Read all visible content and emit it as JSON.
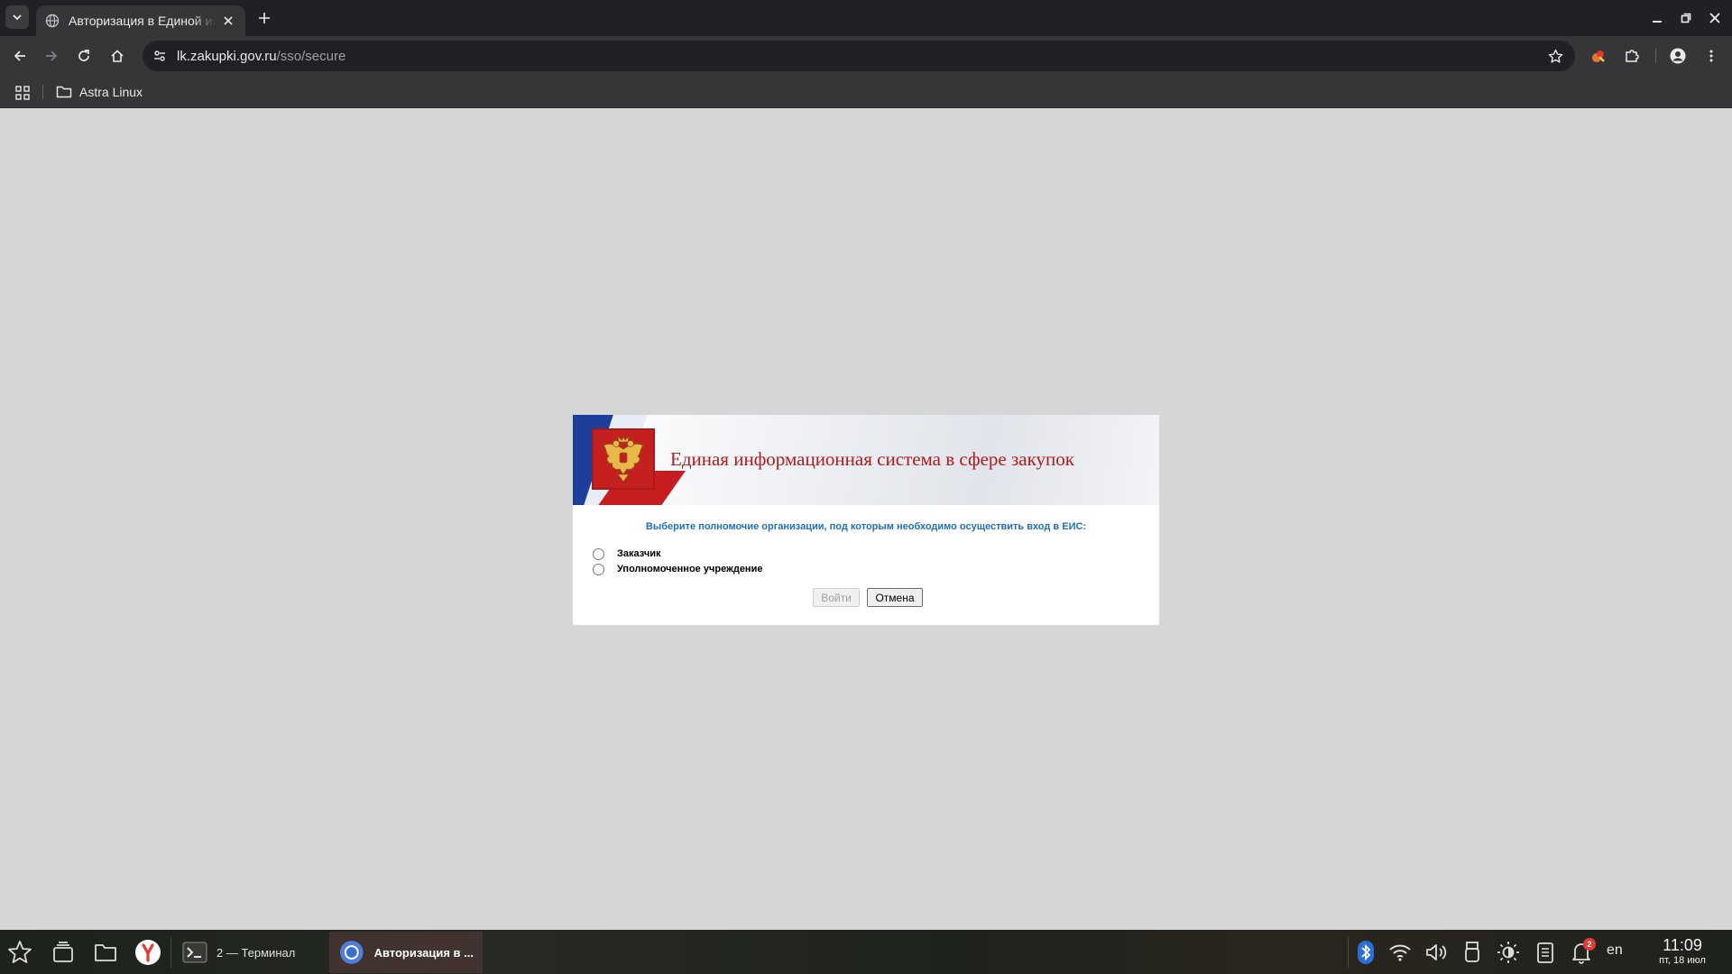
{
  "browser": {
    "tab": {
      "title": "Авторизация в Единой информационной системе",
      "favicon": "globe-icon"
    },
    "url": {
      "host": "lk.zakupki.gov.ru",
      "path": "/sso/secure"
    },
    "bookmarks": [
      {
        "label": "Astra Linux",
        "icon": "folder-icon"
      }
    ]
  },
  "dialog": {
    "banner_title": "Единая информационная система в сфере закупок",
    "prompt": "Выберите полномочие организации, под которым необходимо осуществить вход в ЕИС:",
    "options": [
      {
        "label": "Заказчик",
        "checked": false
      },
      {
        "label": "Уполномоченное учреждение",
        "checked": false
      }
    ],
    "login_label": "Войти",
    "cancel_label": "Отмена"
  },
  "taskbar": {
    "tasks": [
      {
        "label": "2 — Терминал",
        "icon": "terminal-icon"
      },
      {
        "label": "Авторизация в ...",
        "icon": "chromium-icon",
        "active": true
      }
    ],
    "notifications_count": "2",
    "language": "en",
    "time": "11:09",
    "date": "пт, 18 июл"
  },
  "colors": {
    "chrome_dark": "#202124",
    "chrome_toolbar": "#353638",
    "page_bg": "#d6d6d6",
    "banner_title": "#b01c1c",
    "prompt": "#1f6fbf"
  }
}
